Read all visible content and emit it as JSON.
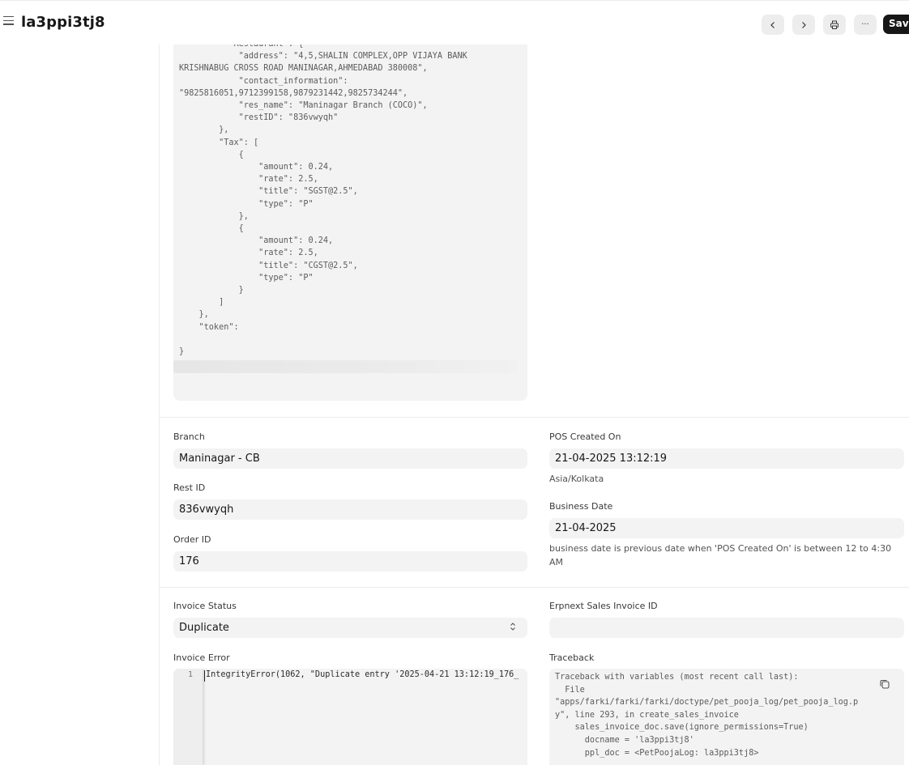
{
  "header": {
    "title": "la3ppi3tj8",
    "prev_icon": "chevron-left-icon",
    "next_icon": "chevron-right-icon",
    "print_icon": "printer-icon",
    "more_label": "···",
    "save_label": "Save"
  },
  "payload_json": {
    "text": "          \"Restaurant\": {\n            \"address\": \"4,5,SHALIN COMPLEX,OPP VIJAYA BANK\nKRISHNABUG CROSS ROAD MANINAGAR,AHMEDABAD 380008\",\n            \"contact_information\":\n\"9825816051,9712399158,9879231442,9825734244\",\n            \"res_name\": \"Maninagar Branch (COCO)\",\n            \"restID\": \"836vwyqh\"\n        },\n        \"Tax\": [\n            {\n                \"amount\": 0.24,\n                \"rate\": 2.5,\n                \"title\": \"SGST@2.5\",\n                \"type\": \"P\"\n            },\n            {\n                \"amount\": 0.24,\n                \"rate\": 2.5,\n                \"title\": \"CGST@2.5\",\n                \"type\": \"P\"\n            }\n        ]\n    },\n    \"token\":\n\n}"
  },
  "fields": {
    "branch": {
      "label": "Branch",
      "value": "Maninagar - CB"
    },
    "rest_id": {
      "label": "Rest ID",
      "value": "836vwyqh"
    },
    "order_id": {
      "label": "Order ID",
      "value": "176"
    },
    "pos_created_on": {
      "label": "POS Created On",
      "value": "21-04-2025 13:12:19",
      "timezone": "Asia/Kolkata"
    },
    "business_date": {
      "label": "Business Date",
      "value": "21-04-2025",
      "help": "business date is previous date when 'POS Created On' is between 12 to 4:30 AM"
    },
    "invoice_status": {
      "label": "Invoice Status",
      "value": "Duplicate",
      "arrow_icon": "select-updown-icon"
    },
    "erpnext_sales_invoice_id": {
      "label": "Erpnext Sales Invoice ID",
      "value": ""
    },
    "invoice_error": {
      "label": "Invoice Error",
      "line_number": "1",
      "line": "IntegrityError(1062, \"Duplicate entry '2025-04-21 13:12:19_176_"
    },
    "traceback": {
      "label": "Traceback",
      "text": "Traceback with variables (most recent call last):\n  File\n\"apps/farki/farki/farki/doctype/pet_pooja_log/pet_pooja_log.p\ny\", line 293, in create_sales_invoice\n    sales_invoice_doc.save(ignore_permissions=True)\n      docname = 'la3ppi3tj8'\n      ppl_doc = <PetPoojaLog: la3ppi3tj8>"
    }
  }
}
